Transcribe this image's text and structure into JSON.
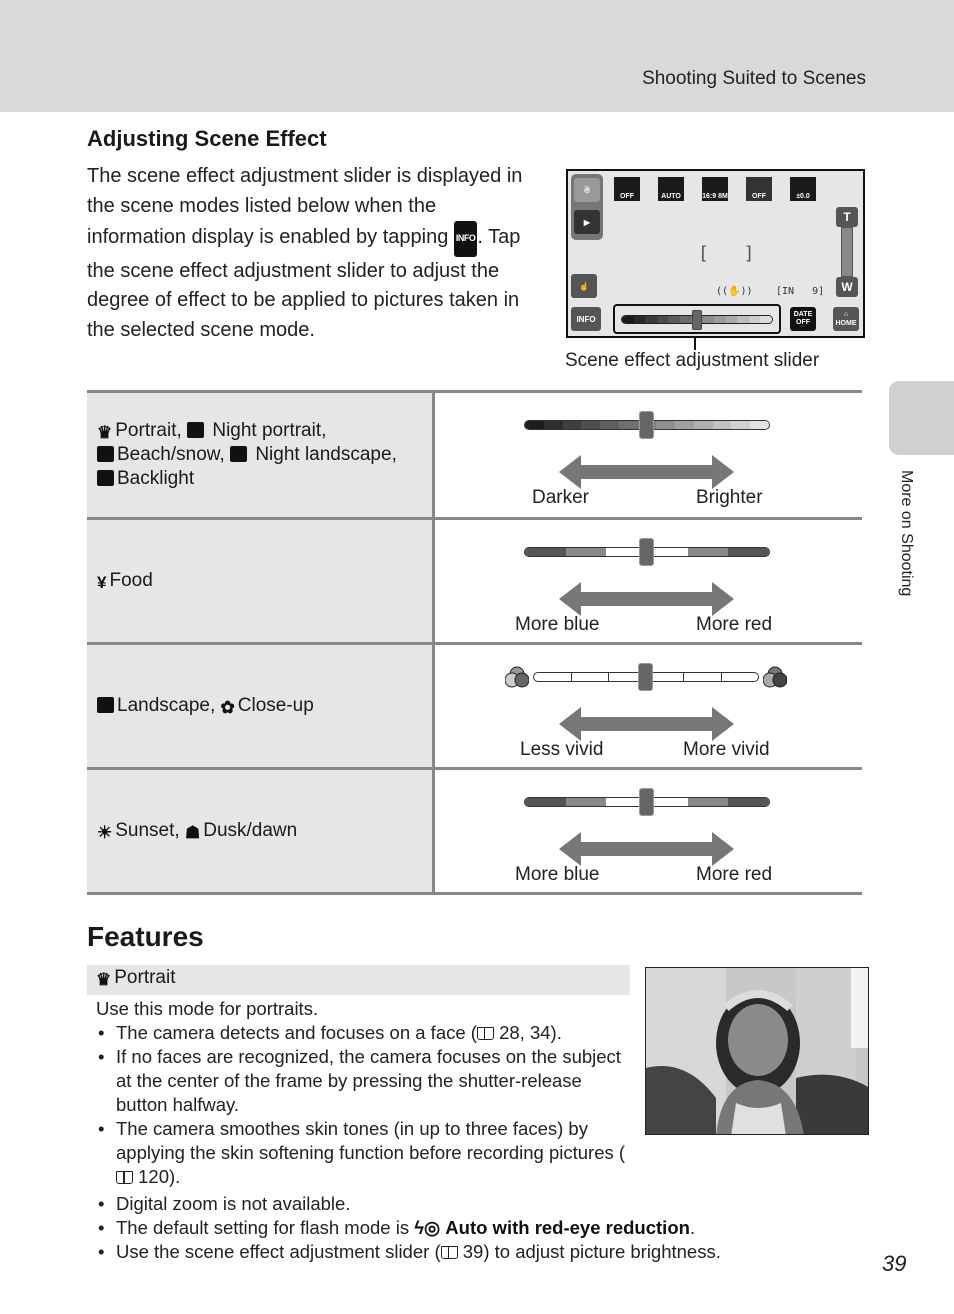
{
  "header": {
    "title": "Shooting Suited to Scenes"
  },
  "adjusting": {
    "title": "Adjusting Scene Effect",
    "intro_part1": "The scene effect adjustment slider is displayed in the scene modes listed below when the information display is enabled by tapping ",
    "info_icon_label": "INFO",
    "intro_part2": ". Tap the scene effect adjustment slider to adjust the degree of effect to be applied to pictures taken in the selected scene mode."
  },
  "camera_screen": {
    "top_icons": [
      {
        "icon": "self-timer-icon",
        "label": "OFF"
      },
      {
        "icon": "flash-icon",
        "label": "AUTO"
      },
      {
        "icon": "image-mode-icon",
        "label": "16:9 8M"
      },
      {
        "icon": "smile-timer-icon",
        "label": "OFF"
      },
      {
        "icon": "exposure-compensation-icon",
        "label": "±0.0"
      }
    ],
    "zoom_t": "T",
    "zoom_w": "W",
    "info_button": "INFO",
    "date_label": "DATE",
    "date_value": "OFF",
    "home_label": "HOME",
    "remaining": "9",
    "internal_memory": "IN",
    "slider_position": 0.5
  },
  "callout": "Scene effect adjustment slider",
  "scene_table": [
    {
      "modes_lines": [
        "Portrait, ",
        "Night portrait,",
        "Beach/snow, ",
        "Night landscape,",
        "Backlight"
      ],
      "slider_type": "gradient",
      "slider_position": 0.5,
      "left_label": "Darker",
      "right_label": "Brighter"
    },
    {
      "modes": "Food",
      "slider_type": "color",
      "slider_position": 0.5,
      "left_label": "More blue",
      "right_label": "More red"
    },
    {
      "modes_a": "Landscape, ",
      "modes_b": "Close-up",
      "slider_type": "vivid",
      "slider_position": 0.5,
      "left_label": "Less vivid",
      "right_label": "More vivid"
    },
    {
      "modes_a": "Sunset, ",
      "modes_b": "Dusk/dawn",
      "slider_type": "color",
      "slider_position": 0.5,
      "left_label": "More blue",
      "right_label": "More red"
    }
  ],
  "features": {
    "title": "Features",
    "mode_name": "Portrait",
    "intro": "Use this mode for portraits.",
    "bullets": [
      {
        "text": "The camera detects and focuses on a face (",
        "ref": "28, 34",
        "after": ")."
      },
      {
        "text": "If no faces are recognized, the camera focuses on the subject at the center of the frame by pressing the shutter-release button halfway."
      },
      {
        "text": "The camera smoothes skin tones (in up to three faces) by applying the skin softening function before recording pictures (",
        "ref": "120",
        "after": ")."
      },
      {
        "text": "Digital zoom is not available."
      },
      {
        "text": "The default setting for flash mode is ",
        "bold": "Auto with red-eye reduction",
        "after": "."
      },
      {
        "text": "Use the scene effect adjustment slider (",
        "ref": "39",
        "after": ") to adjust picture brightness."
      }
    ]
  },
  "side_tab": {
    "label": "More on Shooting"
  },
  "page_number": "39"
}
